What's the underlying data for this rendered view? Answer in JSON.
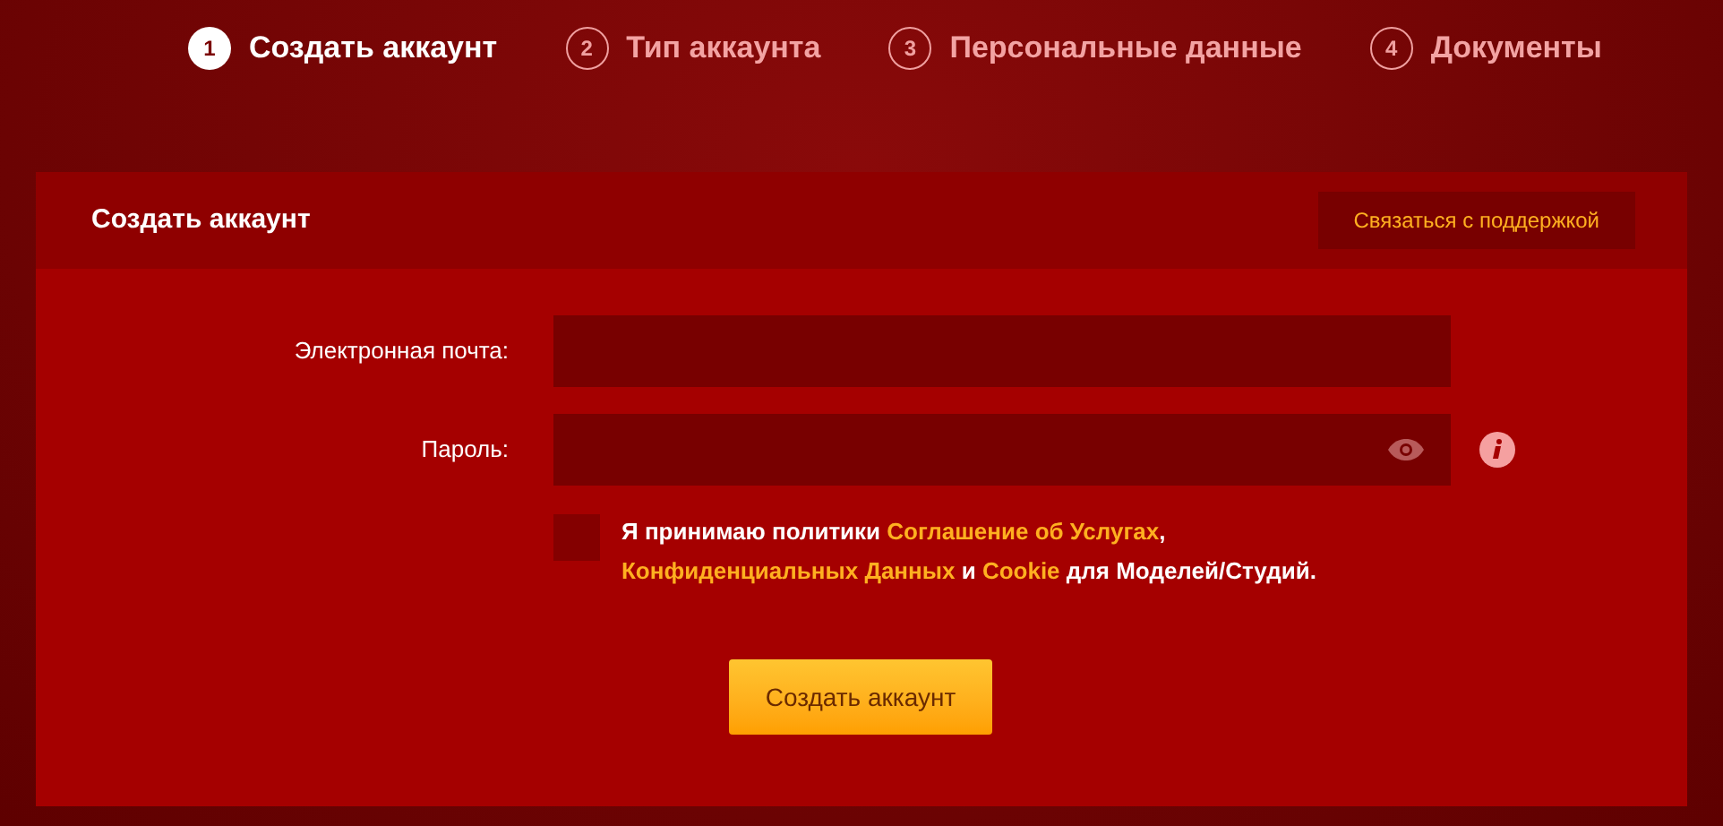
{
  "steps": [
    {
      "number": "1",
      "label": "Создать аккаунт",
      "selected": true
    },
    {
      "number": "2",
      "label": "Тип аккаунта",
      "selected": false
    },
    {
      "number": "3",
      "label": "Персональные данные",
      "selected": false
    },
    {
      "number": "4",
      "label": "Документы",
      "selected": false
    }
  ],
  "card": {
    "title": "Создать аккаунт",
    "support_button": "Связаться с поддержкой"
  },
  "form": {
    "email": {
      "label": "Электронная почта:"
    },
    "password": {
      "label": "Пароль:"
    },
    "terms": {
      "checked": false,
      "parts": [
        {
          "kind": "text",
          "text": "Я принимаю политики "
        },
        {
          "kind": "link",
          "text": "Соглашение об Услугах"
        },
        {
          "kind": "text",
          "text": ", "
        },
        {
          "kind": "link",
          "text": "Конфиденциальных Данных"
        },
        {
          "kind": "text",
          "text": " и "
        },
        {
          "kind": "link",
          "text": "Cookie"
        },
        {
          "kind": "text",
          "text": " для Моделей/Студий."
        }
      ]
    },
    "submit": "Создать аккаунт"
  }
}
